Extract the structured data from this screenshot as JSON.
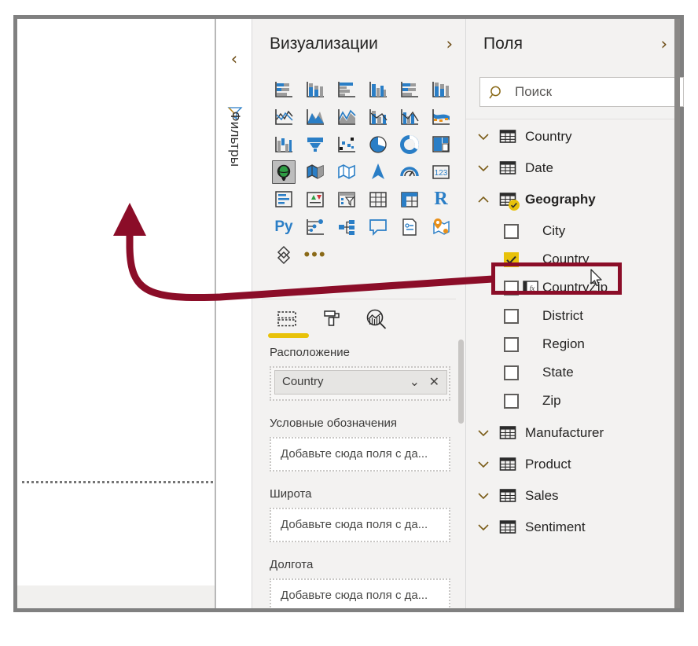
{
  "app": {
    "accent_gold": "#e8c20a",
    "annotation_color": "#8b0d28",
    "pane_bg": "#f3f2f1"
  },
  "filters_rail": {
    "collapse_icon": "chevron-left-icon",
    "filter_icon": "funnel-icon",
    "label": "Фильтры"
  },
  "visualizations": {
    "title": "Визуализации",
    "expand_icon": "chevron-right-icon",
    "icons": [
      {
        "name": "stacked-bar-chart-icon",
        "selected": false
      },
      {
        "name": "stacked-column-chart-icon",
        "selected": false
      },
      {
        "name": "clustered-bar-chart-icon",
        "selected": false
      },
      {
        "name": "clustered-column-chart-icon",
        "selected": false
      },
      {
        "name": "100-stacked-bar-chart-icon",
        "selected": false
      },
      {
        "name": "100-stacked-column-chart-icon",
        "selected": false
      },
      {
        "name": "line-chart-icon",
        "selected": false
      },
      {
        "name": "area-chart-icon",
        "selected": false
      },
      {
        "name": "stacked-area-chart-icon",
        "selected": false
      },
      {
        "name": "line-stacked-column-chart-icon",
        "selected": false
      },
      {
        "name": "line-clustered-column-chart-icon",
        "selected": false
      },
      {
        "name": "ribbon-chart-icon",
        "selected": false
      },
      {
        "name": "waterfall-chart-icon",
        "selected": false
      },
      {
        "name": "funnel-chart-icon",
        "selected": false
      },
      {
        "name": "scatter-chart-icon",
        "selected": false
      },
      {
        "name": "pie-chart-icon",
        "selected": false
      },
      {
        "name": "donut-chart-icon",
        "selected": false
      },
      {
        "name": "treemap-icon",
        "selected": false
      },
      {
        "name": "map-icon",
        "selected": true
      },
      {
        "name": "filled-map-icon",
        "selected": false
      },
      {
        "name": "shape-map-icon",
        "selected": false
      },
      {
        "name": "arcgis-map-icon",
        "selected": false
      },
      {
        "name": "gauge-icon",
        "selected": false
      },
      {
        "name": "card-icon",
        "selected": false
      },
      {
        "name": "multi-row-card-icon",
        "selected": false
      },
      {
        "name": "kpi-icon",
        "selected": false
      },
      {
        "name": "slicer-icon",
        "selected": false
      },
      {
        "name": "table-icon",
        "selected": false
      },
      {
        "name": "matrix-icon",
        "selected": false
      },
      {
        "name": "r-script-visual-icon",
        "selected": false
      },
      {
        "name": "python-visual-icon",
        "selected": false
      },
      {
        "name": "key-influencers-icon",
        "selected": false
      },
      {
        "name": "decomposition-tree-icon",
        "selected": false
      },
      {
        "name": "qa-visual-icon",
        "selected": false
      },
      {
        "name": "paginated-report-icon",
        "selected": false
      },
      {
        "name": "azure-map-icon",
        "selected": false
      },
      {
        "name": "power-apps-icon",
        "selected": false
      },
      {
        "name": "more-options-icon",
        "selected": false
      }
    ],
    "well_tabs": [
      {
        "name": "fields-tab",
        "icon": "fields-pane-icon",
        "active": true
      },
      {
        "name": "format-tab",
        "icon": "paint-roller-icon",
        "active": false
      },
      {
        "name": "analytics-tab",
        "icon": "analytics-magnifier-icon",
        "active": false
      }
    ],
    "wells": [
      {
        "label": "Расположение",
        "chip": "Country",
        "placeholder": null,
        "caret_icon": "chevron-down-icon",
        "close_icon": "close-icon"
      },
      {
        "label": "Условные обозначения",
        "chip": null,
        "placeholder": "Добавьте сюда поля с да..."
      },
      {
        "label": "Широта",
        "chip": null,
        "placeholder": "Добавьте сюда поля с да..."
      },
      {
        "label": "Долгота",
        "chip": null,
        "placeholder": "Добавьте сюда поля с да..."
      }
    ]
  },
  "fields": {
    "title": "Поля",
    "expand_icon": "chevron-right-icon",
    "search": {
      "placeholder": "Поиск",
      "value": "",
      "icon": "search-icon"
    },
    "tables": [
      {
        "label": "Country",
        "expanded": false,
        "badge": false,
        "bold": false
      },
      {
        "label": "Date",
        "expanded": false,
        "badge": false,
        "bold": false
      },
      {
        "label": "Geography",
        "expanded": true,
        "badge": true,
        "bold": true
      },
      {
        "label": "Manufacturer",
        "expanded": false,
        "badge": false,
        "bold": false
      },
      {
        "label": "Product",
        "expanded": false,
        "badge": false,
        "bold": false
      },
      {
        "label": "Sales",
        "expanded": false,
        "badge": false,
        "bold": false
      },
      {
        "label": "Sentiment",
        "expanded": false,
        "badge": false,
        "bold": false
      }
    ],
    "geography_columns": [
      {
        "label": "City",
        "checked": false,
        "has_fx": false,
        "highlighted": false
      },
      {
        "label": "Country",
        "checked": true,
        "has_fx": false,
        "highlighted": true
      },
      {
        "label": "CountryZip",
        "checked": false,
        "has_fx": true,
        "highlighted": false
      },
      {
        "label": "District",
        "checked": false,
        "has_fx": false,
        "highlighted": false
      },
      {
        "label": "Region",
        "checked": false,
        "has_fx": false,
        "highlighted": false
      },
      {
        "label": "State",
        "checked": false,
        "has_fx": false,
        "highlighted": false
      },
      {
        "label": "Zip",
        "checked": false,
        "has_fx": false,
        "highlighted": false
      }
    ]
  },
  "annotations": {
    "arrow": {
      "name": "callout-arrow",
      "color": "#8b0d28",
      "from": "geography-country-field",
      "to": "report-canvas"
    },
    "highlight_box": {
      "name": "country-field-highlight",
      "color": "#8b0d28"
    }
  },
  "canvas": {
    "cursor_icon": "mouse-pointer-icon",
    "guide_line": "dotted-guide-line"
  }
}
